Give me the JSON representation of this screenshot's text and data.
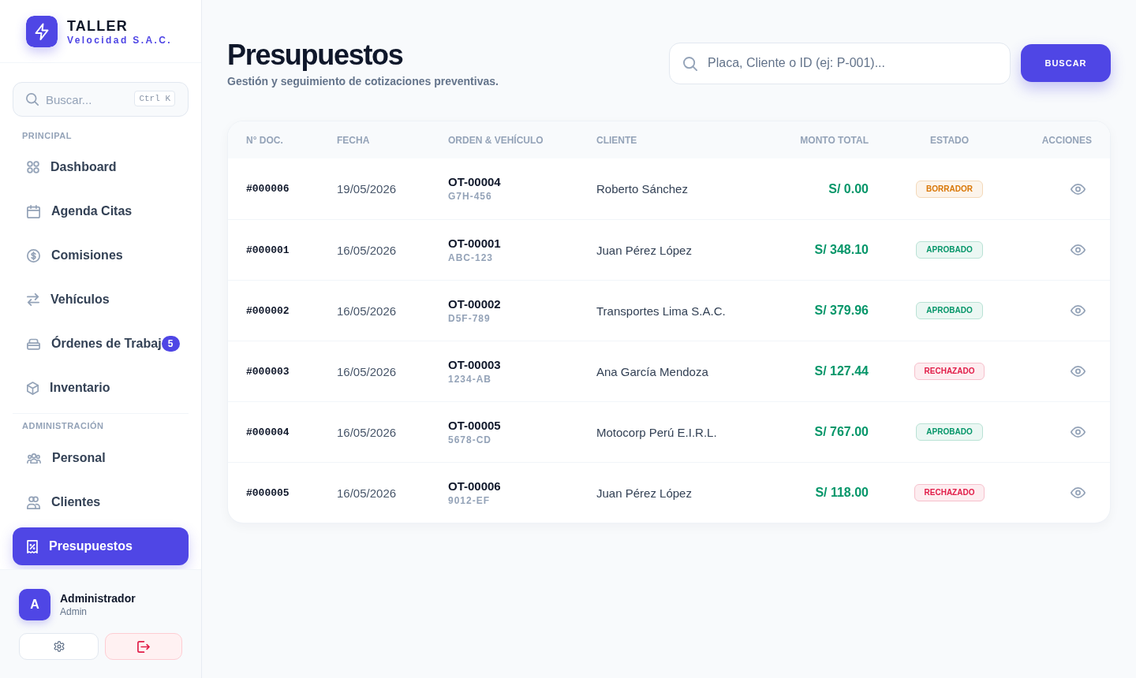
{
  "sidebar": {
    "brand": {
      "name": "TALLER",
      "tagline": "Velocidad S.A.C."
    },
    "search": {
      "placeholder": "Buscar...",
      "shortcut": "Ctrl K"
    },
    "sections": [
      {
        "title": "PRINCIPAL",
        "items": [
          {
            "label": "Dashboard",
            "selected": false
          },
          {
            "label": "Agenda Citas",
            "selected": false
          },
          {
            "label": "Comisiones",
            "selected": false
          },
          {
            "label": "Vehículos",
            "selected": false
          },
          {
            "label": "Órdenes de Trabaj",
            "selected": false,
            "badge": "5"
          },
          {
            "label": "Inventario",
            "selected": false
          }
        ]
      },
      {
        "title": "ADMINISTRACIÓN",
        "items": [
          {
            "label": "Personal",
            "selected": false
          },
          {
            "label": "Clientes",
            "selected": false
          },
          {
            "label": "Presupuestos",
            "selected": true
          }
        ]
      }
    ],
    "user": {
      "initial": "A",
      "name": "Administrador",
      "role": "Admin"
    }
  },
  "header": {
    "title": "Presupuestos",
    "subtitle": "Gestión y seguimiento de cotizaciones preventivas.",
    "search": {
      "placeholder": "Placa, Cliente o ID (ej: P-001)..."
    },
    "search_button": "BUSCAR"
  },
  "table": {
    "columns": [
      "N° DOC.",
      "FECHA",
      "ORDEN & VEHÍCULO",
      "CLIENTE",
      "MONTO TOTAL",
      "ESTADO",
      "ACCIONES"
    ],
    "rows": [
      {
        "doc": "#000006",
        "date": "19/05/2026",
        "order": "OT-00004",
        "plate": "G7H-456",
        "client": "Roberto Sánchez",
        "total": "S/ 0.00",
        "status": {
          "label": "BORRADOR",
          "color": "#d97706"
        }
      },
      {
        "doc": "#000001",
        "date": "16/05/2026",
        "order": "OT-00001",
        "plate": "ABC-123",
        "client": "Juan Pérez López",
        "total": "S/ 348.10",
        "status": {
          "label": "APROBADO",
          "color": "#059669"
        }
      },
      {
        "doc": "#000002",
        "date": "16/05/2026",
        "order": "OT-00002",
        "plate": "D5F-789",
        "client": "Transportes Lima S.A.C.",
        "total": "S/ 379.96",
        "status": {
          "label": "APROBADO",
          "color": "#059669"
        }
      },
      {
        "doc": "#000003",
        "date": "16/05/2026",
        "order": "OT-00003",
        "plate": "1234-AB",
        "client": "Ana García Mendoza",
        "total": "S/ 127.44",
        "status": {
          "label": "RECHAZADO",
          "color": "#e11d48"
        }
      },
      {
        "doc": "#000004",
        "date": "16/05/2026",
        "order": "OT-00005",
        "plate": "5678-CD",
        "client": "Motocorp Perú E.I.R.L.",
        "total": "S/ 767.00",
        "status": {
          "label": "APROBADO",
          "color": "#059669"
        }
      },
      {
        "doc": "#000005",
        "date": "16/05/2026",
        "order": "OT-00006",
        "plate": "9012-EF",
        "client": "Juan Pérez López",
        "total": "S/ 118.00",
        "status": {
          "label": "RECHAZADO",
          "color": "#e11d48"
        }
      }
    ]
  }
}
